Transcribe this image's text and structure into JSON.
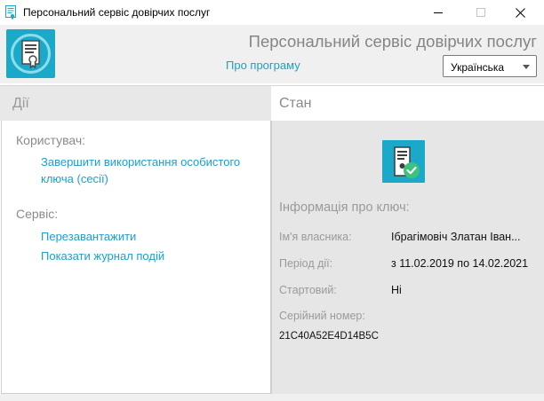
{
  "window": {
    "title": "Персональний сервіс довірчих послуг"
  },
  "header": {
    "app_title": "Персональний сервіс довірчих послуг",
    "about_link": "Про програму",
    "language": {
      "selected": "Українська"
    }
  },
  "actions_panel": {
    "heading": "Дії",
    "user_section": {
      "label": "Користувач:",
      "finish_session_line1": "Завершити використання особистого",
      "finish_session_line2": "ключа (сесії)"
    },
    "service_section": {
      "label": "Сервіс:",
      "restart": "Перезавантажити",
      "show_log": "Показати журнал подій"
    }
  },
  "status_panel": {
    "heading": "Стан",
    "status_icon": "key-valid-icon",
    "key_info_title": "Інформація про ключ:",
    "owner_label": "Ім'я власника:",
    "owner_value": "Ібрагімовіч Златан Іван...",
    "period_label": "Період дії:",
    "period_value": "з 11.02.2019 по 14.02.2021",
    "startup_label": "Стартовий:",
    "startup_value": "Ні",
    "serial_label": "Серійний номер:",
    "serial_value": "21C40A52E4D14B5C"
  },
  "colors": {
    "accent": "#1a9fd1",
    "logo_bg": "#1aa9c9",
    "status_panel_bg": "#e6e6e6",
    "check_green": "#3cc27a"
  }
}
